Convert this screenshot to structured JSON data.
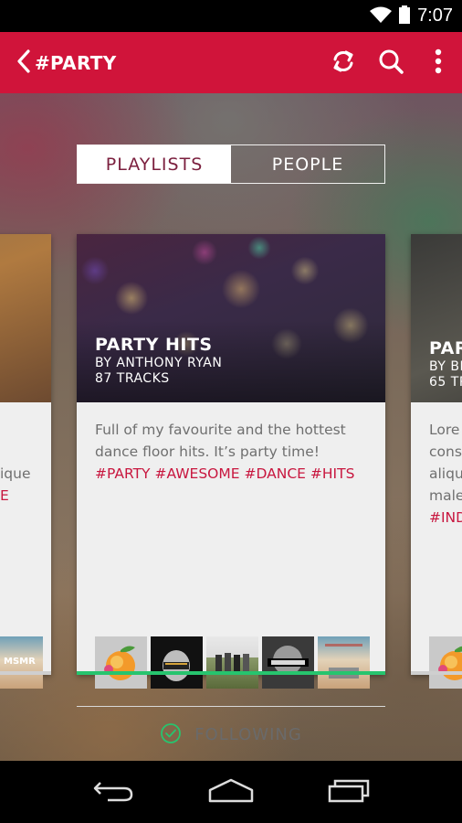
{
  "status_bar": {
    "time": "7:07"
  },
  "app_bar": {
    "title": "#PARTY",
    "icons": [
      "back-icon",
      "refresh-icon",
      "search-icon",
      "overflow-menu-icon"
    ]
  },
  "toggle": {
    "playlists_label": "PLAYLISTS",
    "people_label": "PEOPLE",
    "active": "PLAYLISTS"
  },
  "cards": {
    "main": {
      "title": "PARTY HITS",
      "author": "BY ANTHONY RYAN",
      "tracks": "87 TRACKS",
      "description": "Full of my favourite and the hottest dance floor hits. It’s party time!",
      "tags": [
        "#PARTY",
        "#AWESOME",
        "#DANCE",
        "#HITS"
      ],
      "thumbnails": [
        "peach-album-art",
        "daft-punk-album-art",
        "band-photo-album-art",
        "jay-z-album-art",
        "msmr-album-art"
      ],
      "follow_label": "FOLLOWING",
      "follow_color": "#27c46e"
    },
    "left": {
      "desc_fragment": "ique",
      "tag_fragment": "E",
      "thumb_label_1": "MSMR"
    },
    "right": {
      "title_fragment": "PAR",
      "author_fragment": "BY BI",
      "tracks_fragment": "65 TR",
      "desc_lines": [
        "Lore",
        "cons",
        "aliqu",
        "male"
      ],
      "tag_fragment": "#IND"
    }
  },
  "colors": {
    "primary": "#d0143a",
    "tag": "#c8173f",
    "active_toggle_text": "#7b1f3e"
  }
}
